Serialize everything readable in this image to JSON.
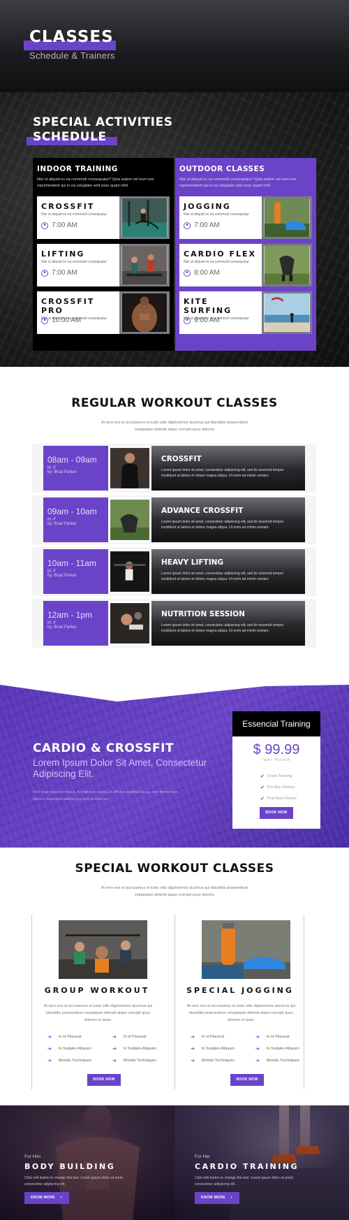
{
  "hero": {
    "title": "CLASSES",
    "subtitle": "Schedule & Trainers"
  },
  "special": {
    "title_line1": "SPECIAL ACTIVITIES",
    "title_line2": "SCHEDULE",
    "indoor": {
      "title": "INDOOR TRAINING",
      "desc": "Nisi ut aliquid ex ea commodi consequatur? Quis autem vel eum iure reprehenderit qui in ea voluptate velit esse quam nihil",
      "cards": [
        {
          "name": "CROSSFIT",
          "desc": "Nisi ut aliquid ex ea commodi consequatur",
          "time": "7:00 AM"
        },
        {
          "name": "LIFTING",
          "desc": "Nisi ut aliquid ex ea commodi consequatur",
          "time": "7:00 AM"
        },
        {
          "name": "CROSSFIT PRO",
          "desc": "Nisi ut aliquid ex ea commodi consequatur",
          "time": "10:00 AM"
        }
      ]
    },
    "outdoor": {
      "title": "OUTDOOR CLASSES",
      "desc": "Nisi ut aliquid ex ea commodi consequatur? Quis autem vel eum iure reprehenderit qui in ea voluptate velit esse quam nihil",
      "cards": [
        {
          "name": "JOGGING",
          "desc": "Nisi ut aliquid ex ea commodi consequatur",
          "time": "7:00 AM"
        },
        {
          "name": "CARDIO FLEX",
          "desc": "Nisi ut aliquid ex ea commodi consequatur",
          "time": "8:00 AM"
        },
        {
          "name": "KITE SURFING",
          "desc": "Nisi ut aliquid ex ea commodi consequatur",
          "time": "9:00 AM"
        }
      ]
    }
  },
  "regular": {
    "title": "REGULAR WORKOUT CLASSES",
    "desc": "At vero eos et accusamus et iusto odio dignissimos ducimus qui blanditiis praesentium voluptatum deleniti atque corrupti quos dolores",
    "rows": [
      {
        "time": "08am - 09am",
        "days": "M -F",
        "by": "by: Brad Parker",
        "name": "CROSSFIT",
        "text": "Lorem ipsum dolor sit amet, consectetur adipiscing elit, sed do eiusmod tempor incididunt ut labore et dolore magna aliqua. Ut enim ad minim veniam."
      },
      {
        "time": "09am - 10am",
        "days": "M -F",
        "by": "by: Brad Parker",
        "name": "ADVANCE CROSSFIT",
        "text": "Lorem ipsum dolor sit amet, consectetur adipiscing elit, sed do eiusmod tempor incididunt ut labore et dolore magna aliqua. Ut enim ad minim veniam."
      },
      {
        "time": "10am - 11am",
        "days": "M -F",
        "by": "by: Brad Parker",
        "name": "HEAVY LIFTING",
        "text": "Lorem ipsum dolor sit amet, consectetur adipiscing elit, sed do eiusmod tempor incididunt ut labore et dolore magna aliqua. Ut enim ad minim veniam."
      },
      {
        "time": "12am - 1pm",
        "days": "M -F",
        "by": "by: Brad Parker",
        "name": "NUTRITION SESSION",
        "text": "Lorem ipsum dolor sit amet, consectetur adipiscing elit, sed do eiusmod tempor incididunt ut labore et dolore magna aliqua. Ut enim ad minim veniam."
      }
    ]
  },
  "cardio": {
    "title": "CARDIO & CROSSFIT",
    "subtitle": "Lorem Ipsum Dolor Sit Amet, Consectetur Adipiscing Elit.",
    "desc": "Sed vitae placerat metus, in interdum turpis. In efficitur dapibus lacus, non fermentum libero consectetur adipiscing sem id enim ex."
  },
  "pricing": {
    "title": "Essencial Training",
    "price": "$ 99.99",
    "per": "/per month",
    "features": [
      "Cross Training",
      "Pre Run Fitness",
      "Post Run Fitness"
    ],
    "button": "BOOK NOW"
  },
  "special_workout": {
    "title": "SPECIAL WORKOUT CLASSES",
    "desc": "At vero eos et accusamus et iusto odio dignissimos ducimus qui blanditiis praesentium voluptatum deleniti atque corrupti quos dolores",
    "cols": [
      {
        "title": "GROUP WORKOUT",
        "desc": "At vero eos et accusamus et iusto odio dignissimos ducimus qui blanditiis praesentium voluptatum deleniti atque corrupti quos dolores et quas.",
        "list_left": [
          "In Id Placerat",
          "In Sodales Aliquam",
          "Molotie Techniques"
        ],
        "list_right": [
          "In Id Placerat",
          "In Sodales Aliquam",
          "Molotie Techniques"
        ],
        "button": "BOOK NOW"
      },
      {
        "title": "SPECIAL JOGGING",
        "desc": "At vero eos et accusamus et iusto odio dignissimos ducimus qui blanditiis praesentium voluptatum deleniti atque corrupti quos dolores et quas.",
        "list_left": [
          "In Id Placerat",
          "In Sodales Aliquam",
          "Molotie Techniques"
        ],
        "list_right": [
          "In Id Placerat",
          "In Sodales Aliquam",
          "Molotie Techniques"
        ],
        "button": "BOOK NOW"
      }
    ]
  },
  "banners": [
    {
      "for": "For Him",
      "title": "BODY BUILDING",
      "desc": "Click edit button to change this text. Lorem ipsum dolor sit amet, consectetur adipiscing elit.",
      "button": "KNOW MORE"
    },
    {
      "for": "For Her",
      "title": "CARDIO TRAINING",
      "desc": "Click edit button to change this text. Lorem ipsum dolor sit amet, consectetur adipiscing elit.",
      "button": "KNOW MORE"
    }
  ],
  "colors": {
    "accent": "#6b43c9",
    "dark": "#111111"
  }
}
